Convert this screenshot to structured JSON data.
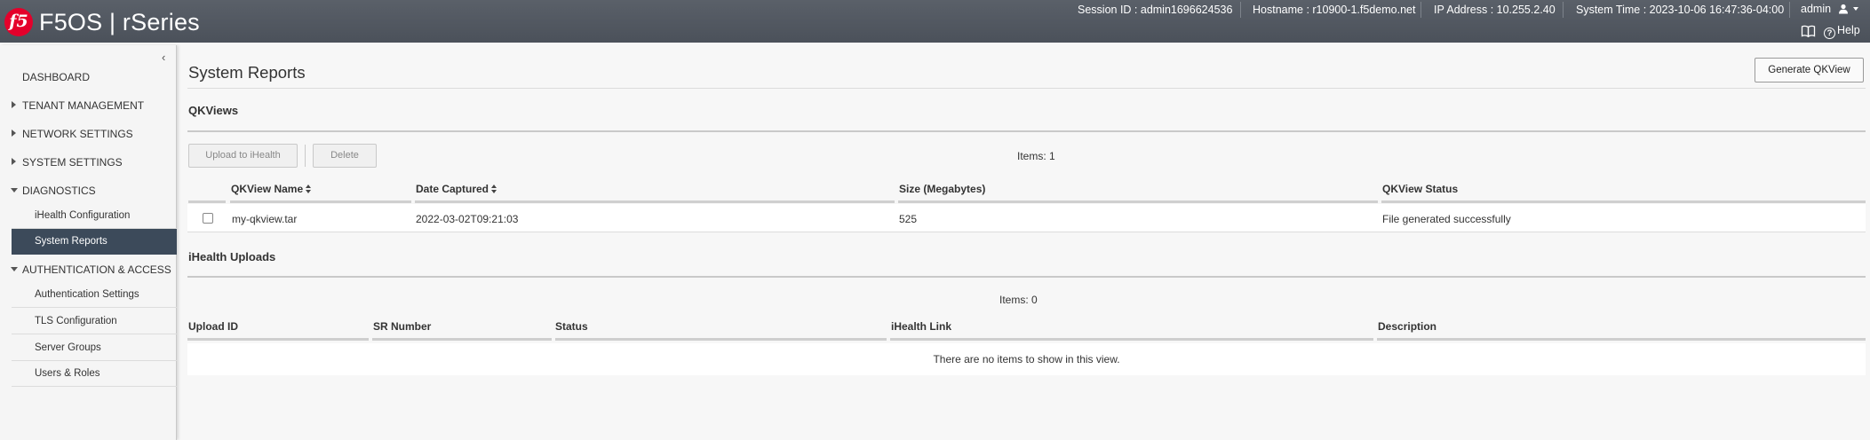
{
  "header": {
    "logo_text": "f5",
    "brand": "F5OS | rSeries",
    "session": "Session ID : admin1696624536",
    "hostname": "Hostname : r10900-1.f5demo.net",
    "ip": "IP Address : 10.255.2.40",
    "system_time": "System Time : 2023-10-06 16:47:36-04:00",
    "user": "admin",
    "help": "Help",
    "bg_color": "#4f555e"
  },
  "sidebar": {
    "collapse_glyph": "‹",
    "items": [
      {
        "label": "DASHBOARD"
      },
      {
        "label": "TENANT MANAGEMENT"
      },
      {
        "label": "NETWORK SETTINGS"
      },
      {
        "label": "SYSTEM SETTINGS"
      },
      {
        "label": "DIAGNOSTICS"
      },
      {
        "label": "AUTHENTICATION & ACCESS"
      }
    ],
    "diagnostics_sub": [
      {
        "label": "iHealth Configuration"
      },
      {
        "label": "System Reports"
      }
    ],
    "auth_sub": [
      {
        "label": "Authentication Settings"
      },
      {
        "label": "TLS Configuration"
      },
      {
        "label": "Server Groups"
      },
      {
        "label": "Users & Roles"
      }
    ],
    "active_color": "#3c4a5a"
  },
  "main": {
    "title": "System Reports",
    "generate_button": "Generate QKView",
    "qkviews": {
      "title": "QKViews",
      "upload_button": "Upload to iHealth",
      "delete_button": "Delete",
      "items_count": "Items: 1",
      "columns": [
        "QKView Name",
        "Date Captured",
        "Size (Megabytes)",
        "QKView Status"
      ],
      "rows": [
        {
          "name": "my-qkview.tar",
          "date": "2022-03-02T09:21:03",
          "size": "525",
          "status": "File generated successfully"
        }
      ]
    },
    "uploads": {
      "title": "iHealth Uploads",
      "items_count": "Items: 0",
      "columns": [
        "Upload ID",
        "SR Number",
        "Status",
        "iHealth Link",
        "Description"
      ],
      "empty_text": "There are no items to show in this view."
    }
  }
}
